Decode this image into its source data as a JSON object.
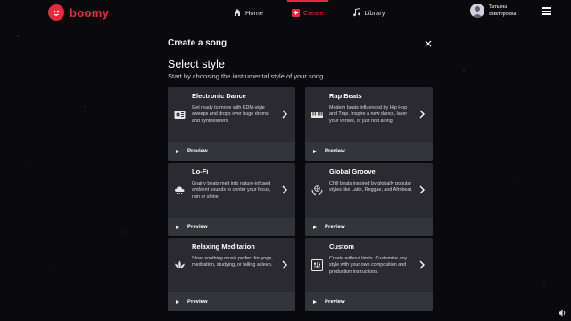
{
  "brand": {
    "name": "boomy",
    "accent": "#e8283d"
  },
  "nav": [
    {
      "label": "Home",
      "icon": "home-icon",
      "active": false
    },
    {
      "label": "Create",
      "icon": "plus-box-icon",
      "active": true
    },
    {
      "label": "Library",
      "icon": "music-note-icon",
      "active": false
    }
  ],
  "user": {
    "first_name": "Татьяна",
    "last_name": "Викторовна"
  },
  "modal": {
    "title": "Create a song",
    "heading": "Select style",
    "subheading": "Start by choosing the instrumental style of your song"
  },
  "styles": [
    {
      "title": "Electronic Dance",
      "description": "Get ready to move with EDM-style sweeps and drops over huge drums and synthesizers",
      "icon": "cassette-icon",
      "preview_label": "Preview"
    },
    {
      "title": "Rap Beats",
      "description": "Modern beats influenced by Hip Hop and Trap. Inspire a new dance, layer your verses, or just nod along.",
      "icon": "keyboard-icon",
      "preview_label": "Preview"
    },
    {
      "title": "Lo-Fi",
      "description": "Grainy beats melt into nature-infused ambient sounds to center your focus, rain or shine.",
      "icon": "cloud-rain-icon",
      "preview_label": "Preview"
    },
    {
      "title": "Global Groove",
      "description": "Chill beats inspired by globally popular styles like Latin, Reggae, and Afrobeat.",
      "icon": "hands-globe-icon",
      "preview_label": "Preview"
    },
    {
      "title": "Relaxing Meditation",
      "description": "Slow, soothing music perfect for yoga, meditation, studying, or falling asleep.",
      "icon": "lotus-icon",
      "preview_label": "Preview"
    },
    {
      "title": "Custom",
      "description": "Create without limits. Customize any style with your own composition and production instructions.",
      "icon": "sliders-icon",
      "preview_label": "Preview"
    }
  ]
}
